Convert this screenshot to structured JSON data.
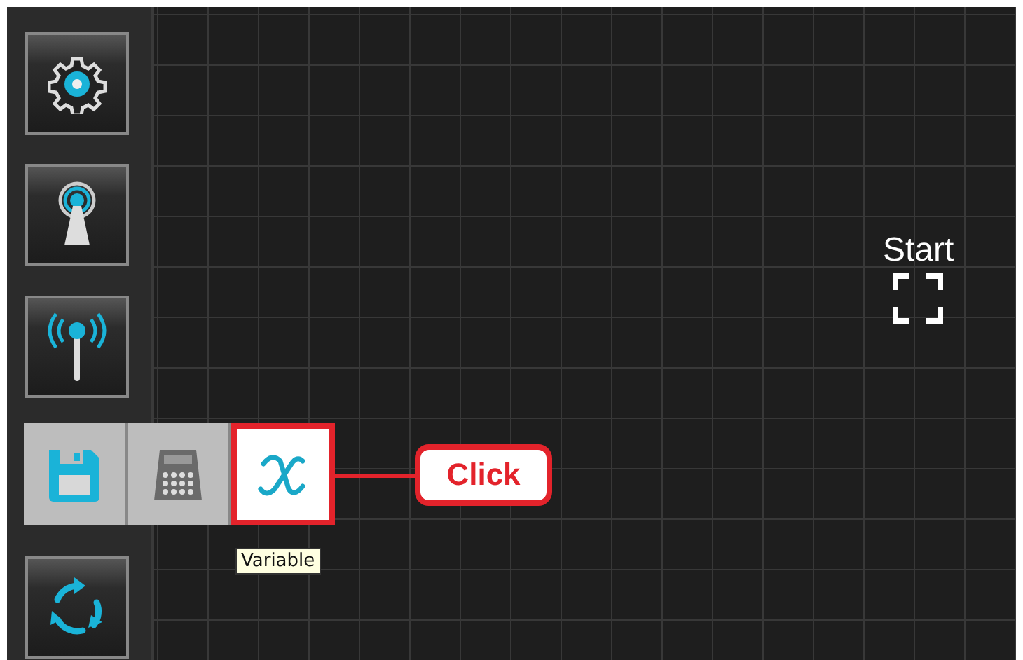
{
  "sidebar": {
    "buttons": [
      {
        "kind": "gear"
      },
      {
        "kind": "beacon"
      },
      {
        "kind": "antenna"
      },
      {
        "kind": "loop"
      }
    ]
  },
  "flyout": {
    "items": [
      {
        "kind": "save",
        "selected": false
      },
      {
        "kind": "calculator",
        "selected": false
      },
      {
        "kind": "variable",
        "selected": true
      }
    ]
  },
  "tooltip": "Variable",
  "callout": "Click",
  "start_node": {
    "label": "Start"
  }
}
